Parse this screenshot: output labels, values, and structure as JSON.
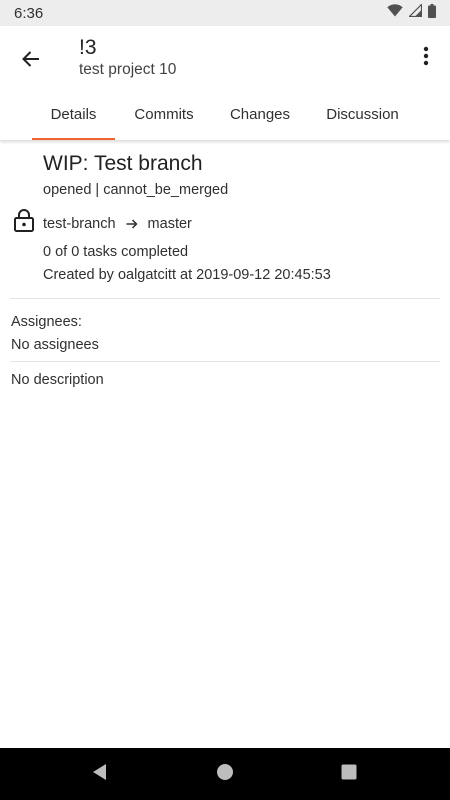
{
  "status_bar": {
    "time": "6:36",
    "icons": [
      "wifi-icon",
      "signal-icon",
      "battery-icon"
    ]
  },
  "app_bar": {
    "title": "!3",
    "subtitle": "test project 10",
    "back_icon": "arrow-back-icon",
    "menu_icon": "more-vert-icon"
  },
  "tabs": [
    {
      "label": "Details",
      "active": true
    },
    {
      "label": "Commits",
      "active": false
    },
    {
      "label": "Changes",
      "active": false
    },
    {
      "label": "Discussion",
      "active": false
    }
  ],
  "details": {
    "title": "WIP: Test branch",
    "state": "opened | cannot_be_merged",
    "source_branch": "test-branch",
    "target_branch": "master",
    "tasks": "0 of 0 tasks completed",
    "created": "Created by oalgatcitt at 2019-09-12 20:45:53",
    "assignees_label": "Assignees:",
    "assignees_value": "No assignees",
    "description": "No description"
  },
  "colors": {
    "accent": "#f0652f",
    "status_bar": "#ededed",
    "nav_bar": "#000000"
  }
}
